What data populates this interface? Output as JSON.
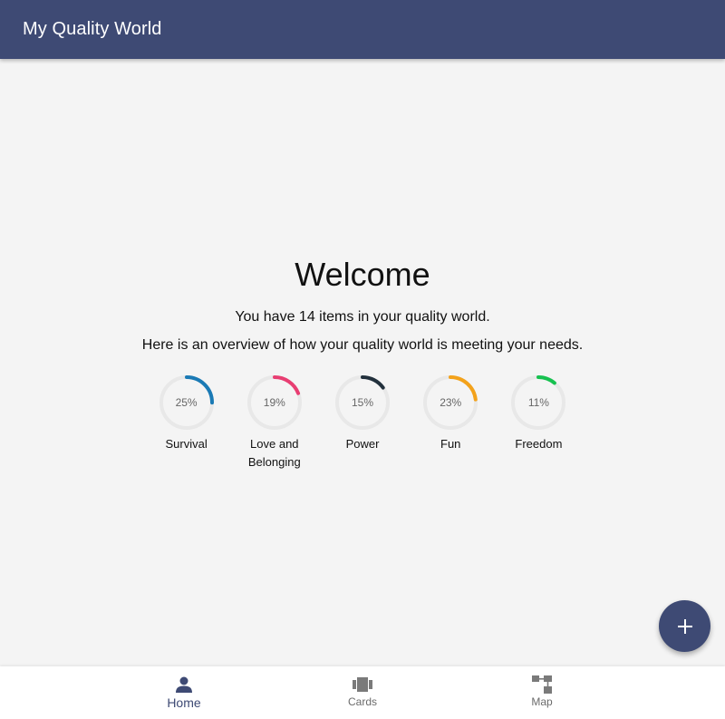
{
  "app": {
    "title": "My Quality World"
  },
  "main": {
    "heading": "Welcome",
    "summary_line1": "You have 14 items in your quality world.",
    "summary_line2": "Here is an overview of how your quality world is meeting your needs.",
    "needs": [
      {
        "label": "Survival",
        "percent": 25,
        "percent_text": "25%",
        "color": "#1a7ab5"
      },
      {
        "label": "Love and Belonging",
        "percent": 19,
        "percent_text": "19%",
        "color": "#e83e72"
      },
      {
        "label": "Power",
        "percent": 15,
        "percent_text": "15%",
        "color": "#22303c"
      },
      {
        "label": "Fun",
        "percent": 23,
        "percent_text": "23%",
        "color": "#f3a21b"
      },
      {
        "label": "Freedom",
        "percent": 11,
        "percent_text": "11%",
        "color": "#17c150"
      }
    ],
    "track_color": "#e8e8e8"
  },
  "fab": {
    "icon": "plus-icon"
  },
  "bottom_nav": {
    "items": [
      {
        "label": "Home",
        "icon": "person-icon",
        "active": true
      },
      {
        "label": "Cards",
        "icon": "cards-icon",
        "active": false
      },
      {
        "label": "Map",
        "icon": "map-icon",
        "active": false
      }
    ]
  },
  "colors": {
    "primary": "#3e4a74",
    "background": "#f4f4f4"
  }
}
